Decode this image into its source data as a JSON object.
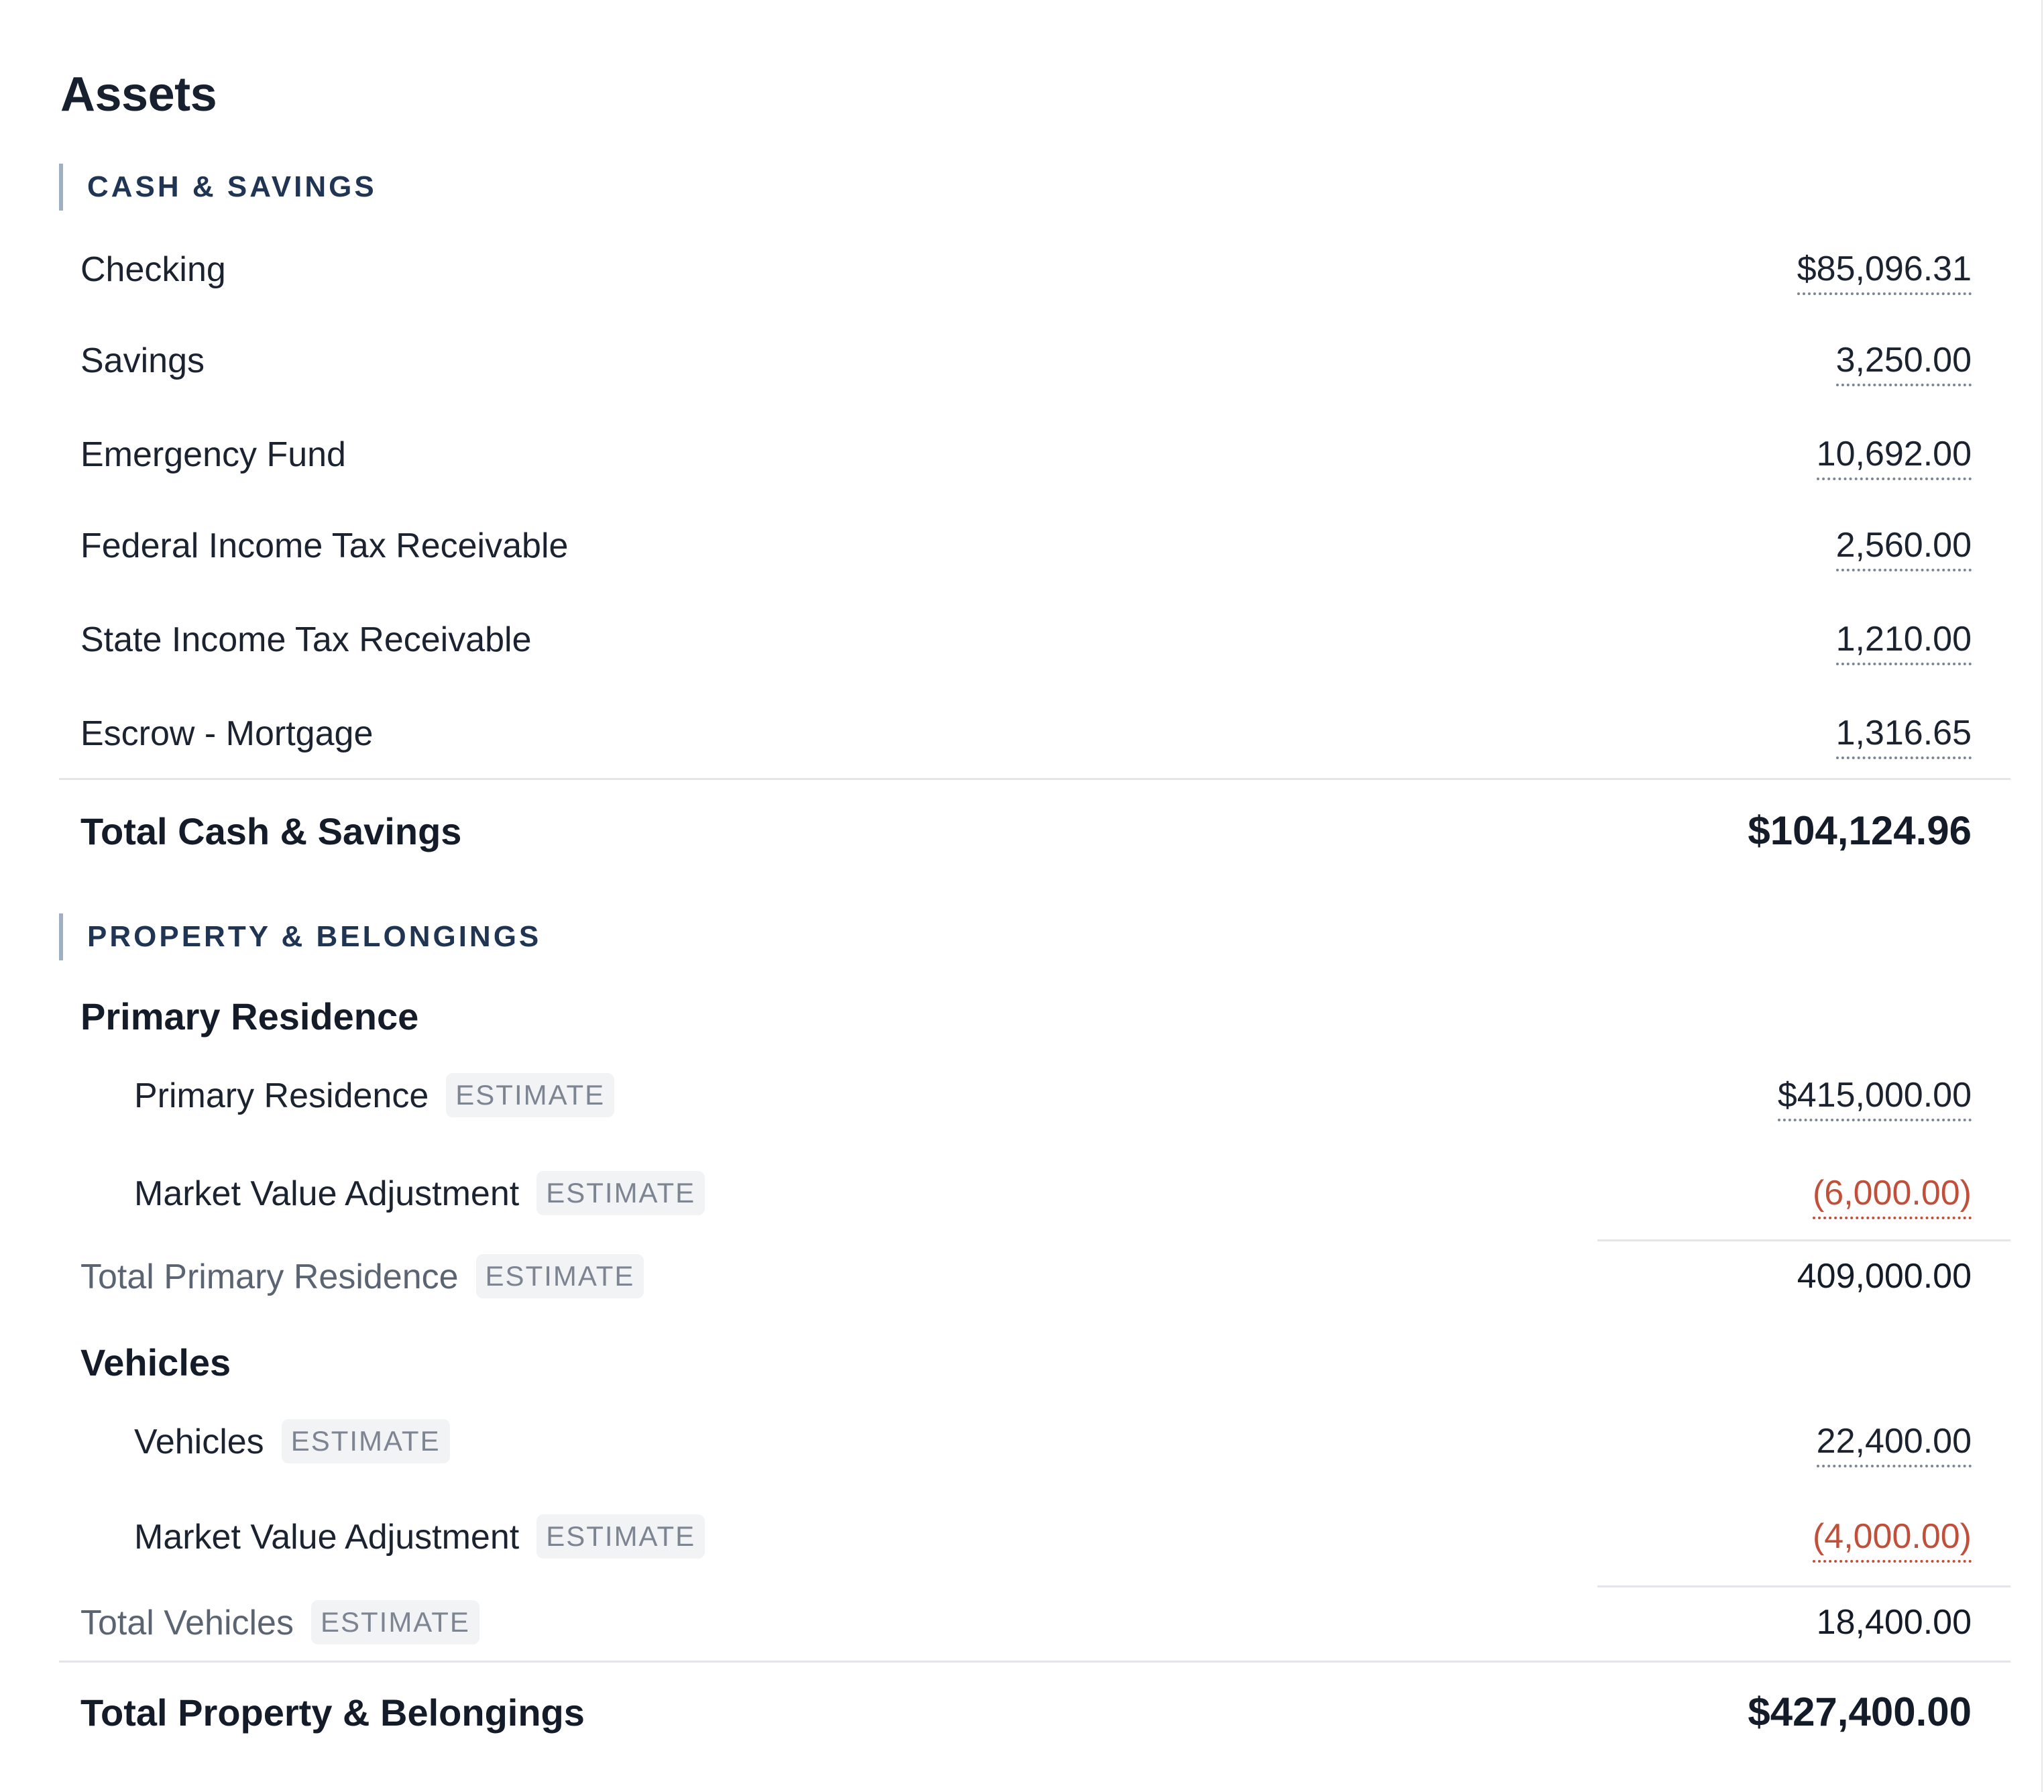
{
  "title": "Assets",
  "cash": {
    "heading": "CASH & SAVINGS",
    "rows": [
      {
        "label": "Checking",
        "value": "$85,096.31"
      },
      {
        "label": "Savings",
        "value": "3,250.00"
      },
      {
        "label": "Emergency Fund",
        "value": "10,692.00"
      },
      {
        "label": "Federal Income Tax Receivable",
        "value": "2,560.00"
      },
      {
        "label": "State Income Tax Receivable",
        "value": "1,210.00"
      },
      {
        "label": "Escrow - Mortgage",
        "value": "1,316.65"
      }
    ],
    "total_label": "Total Cash & Savings",
    "total_value": "$104,124.96"
  },
  "property": {
    "heading": "PROPERTY & BELONGINGS",
    "estimate_badge": "ESTIMATE",
    "residence": {
      "heading": "Primary Residence",
      "rows": [
        {
          "label": "Primary Residence",
          "value": "$415,000.00"
        },
        {
          "label": "Market Value Adjustment",
          "value": "(6,000.00)"
        }
      ],
      "total_label": "Total Primary Residence",
      "total_value": "409,000.00"
    },
    "vehicles": {
      "heading": "Vehicles",
      "rows": [
        {
          "label": "Vehicles",
          "value": "22,400.00"
        },
        {
          "label": "Market Value Adjustment",
          "value": "(4,000.00)"
        }
      ],
      "total_label": "Total Vehicles",
      "total_value": "18,400.00"
    },
    "total_label": "Total Property & Belongings",
    "total_value": "$427,400.00"
  },
  "colors": {
    "negative": "#c0503a",
    "section_bar": "#9fb0c4",
    "heading": "#1f3553"
  }
}
